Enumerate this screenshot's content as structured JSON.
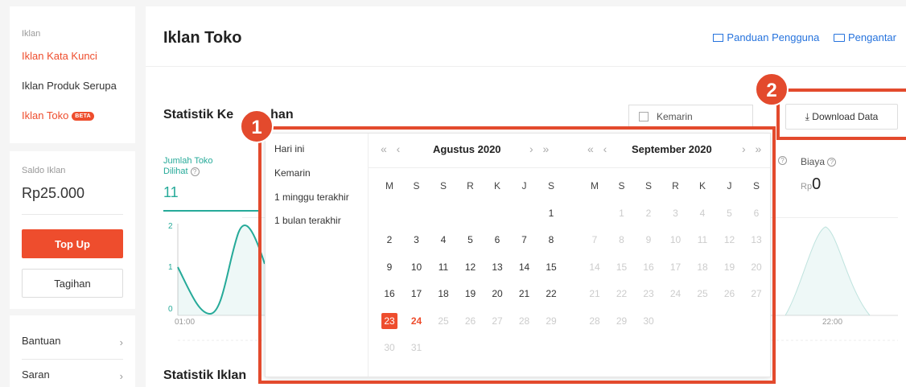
{
  "sidebar": {
    "section_label": "Iklan",
    "items": [
      {
        "label": "Iklan Kata Kunci"
      },
      {
        "label": "Iklan Produk Serupa"
      },
      {
        "label": "Iklan Toko",
        "badge": "BETA"
      }
    ],
    "balance": {
      "label": "Saldo Iklan",
      "value": "Rp25.000"
    },
    "topup_label": "Top Up",
    "tagihan_label": "Tagihan",
    "links": [
      {
        "label": "Bantuan"
      },
      {
        "label": "Saran"
      }
    ]
  },
  "header": {
    "title": "Iklan Toko",
    "guide_link": "Panduan Pengguna",
    "intro_link": "Pengantar"
  },
  "stats": {
    "title": "Statistik Keseluruhan",
    "title_visible_left": "Statistik Ke",
    "title_visible_right": "han",
    "date_range": "Kemarin",
    "download_label": "Download Data",
    "metric_views": {
      "label_line1": "Jumlah Toko",
      "label_line2": "Dilihat",
      "value": "11"
    },
    "metric_cost": {
      "label": "Biaya",
      "currency": "Rp",
      "value": "0"
    },
    "y_ticks": [
      "2",
      "1",
      "0"
    ],
    "x_ticks": [
      "01:00",
      "22:00"
    ]
  },
  "section2_title": "Statistik Iklan",
  "picker": {
    "presets": [
      "Hari ini",
      "Kemarin",
      "1 minggu terakhir",
      "1 bulan terakhir"
    ],
    "left_month": "Agustus 2020",
    "right_month": "September 2020",
    "nav_prev": "« ‹",
    "nav_next": "› »",
    "weekdays": [
      "M",
      "S",
      "S",
      "R",
      "K",
      "J",
      "S"
    ],
    "selected_day": "23",
    "today_day": "24"
  },
  "annotations": {
    "box1": "1",
    "box2": "2"
  },
  "colors": {
    "accent": "#ee4d2d",
    "teal": "#26aa99",
    "link": "#2673dd",
    "annotation": "#e34a2d"
  }
}
